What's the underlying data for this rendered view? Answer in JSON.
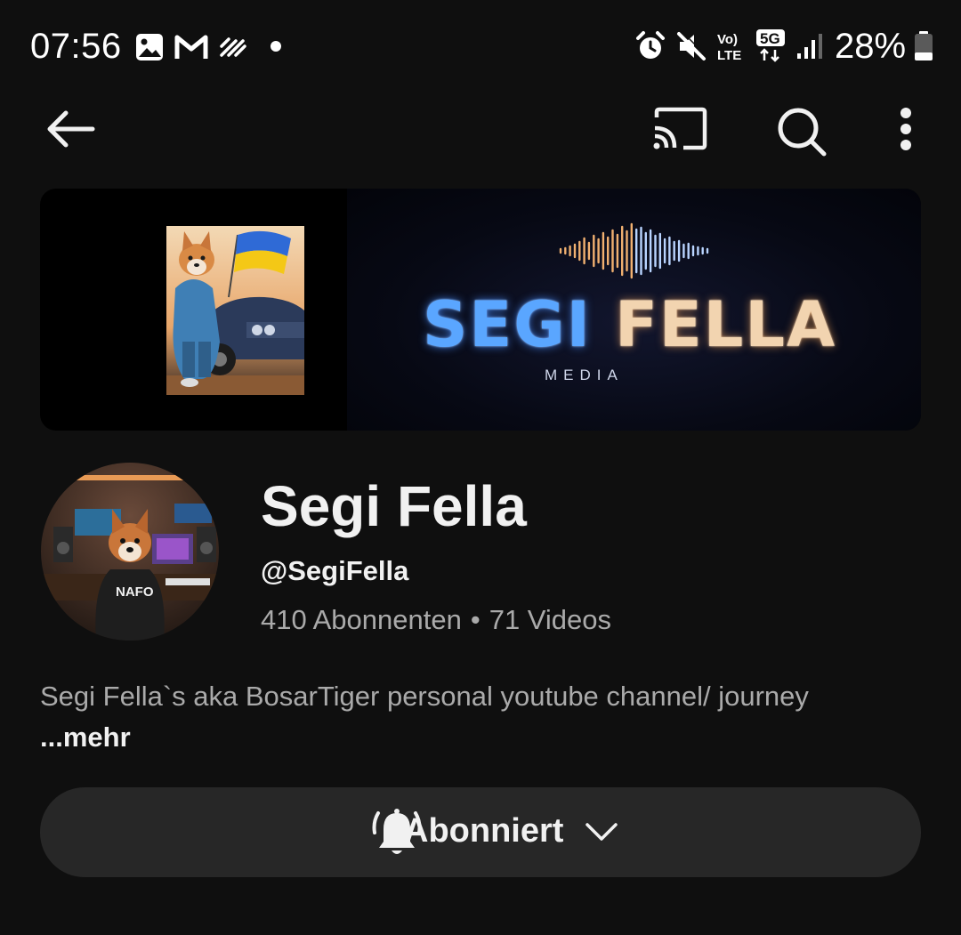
{
  "status_bar": {
    "time": "07:56",
    "battery": "28%",
    "left_icons": [
      "gallery-icon",
      "gmail-icon",
      "signal-app-icon",
      "notification-dot-icon"
    ],
    "right_icons": [
      "alarm-icon",
      "mute-icon",
      "volte-icon",
      "5g-icon",
      "signal-bars-icon",
      "battery-icon"
    ],
    "volte_label": "Vo) LTE",
    "network_label": "5G"
  },
  "app_bar": {
    "icons": [
      "back-arrow-icon",
      "cast-icon",
      "search-icon",
      "more-vert-icon"
    ]
  },
  "banner": {
    "title_part1": "SEGI",
    "title_part2": "FELLA",
    "subtitle": "MEDIA"
  },
  "channel": {
    "name": "Segi Fella",
    "handle": "@SegiFella",
    "subscribers": "410 Abonnenten",
    "separator": "•",
    "videos": "71 Videos",
    "avatar_shirt_text": "NAFO"
  },
  "description": {
    "text": "Segi Fella`s aka BosarTiger personal youtube channel/ journey",
    "more_label": "...mehr"
  },
  "subscribe_button": {
    "label": "Abonniert"
  },
  "colors": {
    "background": "#0f0f0f",
    "text_primary": "#f1f1f1",
    "text_secondary": "#aaaaaa",
    "button_bg": "#272727",
    "banner_blue": "#5aa6ff",
    "banner_gold": "#f2d4b0"
  }
}
